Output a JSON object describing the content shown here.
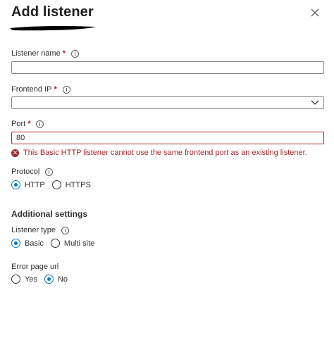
{
  "panel": {
    "title": "Add listener"
  },
  "fields": {
    "listener_name": {
      "label": "Listener name",
      "required_mark": "*",
      "value": ""
    },
    "frontend_ip": {
      "label": "Frontend IP",
      "required_mark": "*",
      "value": ""
    },
    "port": {
      "label": "Port",
      "required_mark": "*",
      "value": "80",
      "error": "This Basic HTTP listener cannot use the same frontend port as an existing listener."
    },
    "protocol": {
      "label": "Protocol",
      "options": [
        "HTTP",
        "HTTPS"
      ],
      "selected": "HTTP"
    }
  },
  "additional": {
    "heading": "Additional settings",
    "listener_type": {
      "label": "Listener type",
      "options": [
        "Basic",
        "Multi site"
      ],
      "selected": "Basic"
    },
    "error_page": {
      "label": "Error page url",
      "options": [
        "Yes",
        "No"
      ],
      "selected": "No"
    }
  },
  "colors": {
    "accent": "#0078d4",
    "error": "#a4262c",
    "text": "#323130"
  }
}
